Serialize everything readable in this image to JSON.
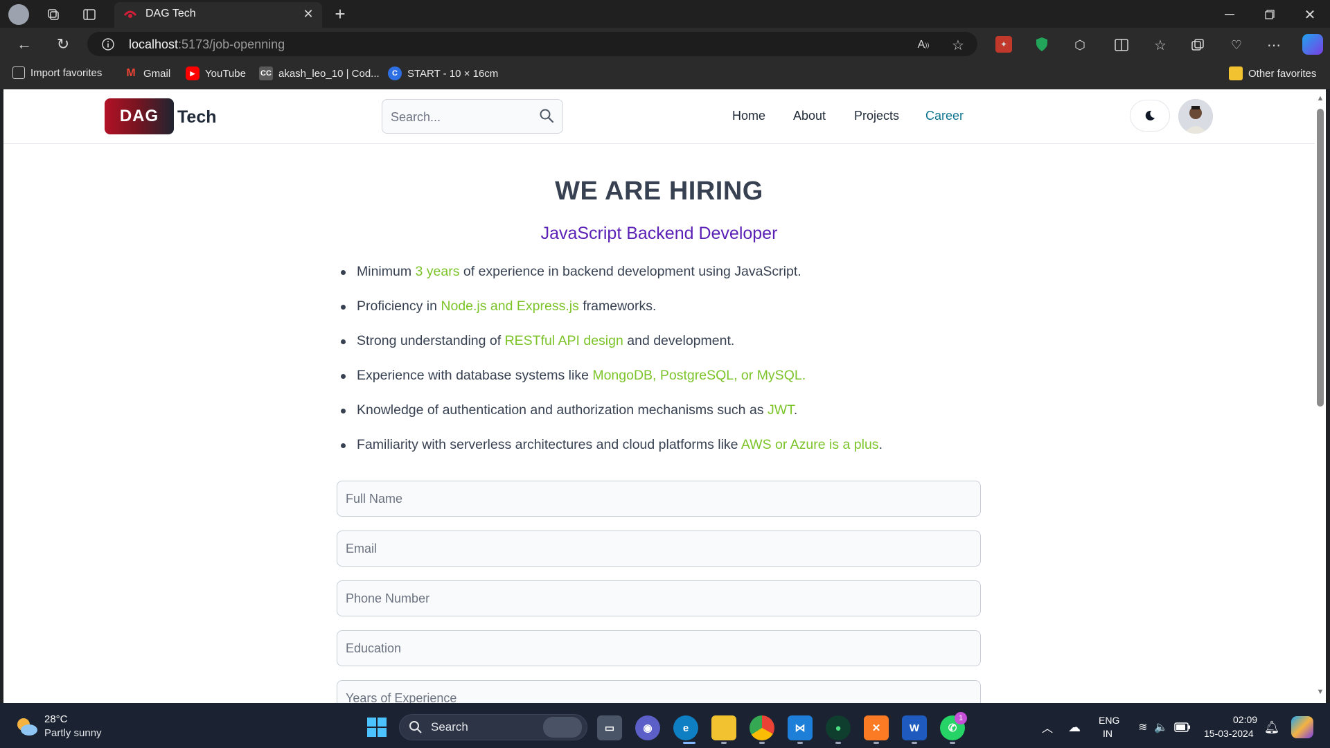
{
  "browser": {
    "tab_title": "DAG Tech",
    "url_host": "localhost",
    "url_path": ":5173/job-openning",
    "favorites": [
      {
        "label": "Import favorites"
      },
      {
        "label": "Gmail"
      },
      {
        "label": "YouTube"
      },
      {
        "label": "akash_leo_10 | Cod..."
      },
      {
        "label": "START - 10 × 16cm"
      }
    ],
    "other_favorites": "Other favorites"
  },
  "navbar": {
    "logo_box": "DAG",
    "logo_rest": "Tech",
    "search_placeholder": "Search...",
    "links": [
      "Home",
      "About",
      "Projects",
      "Career"
    ],
    "active_link": "Career"
  },
  "content": {
    "title": "WE ARE HIRING",
    "job_title": "JavaScript Backend Developer",
    "requirements": [
      {
        "pre": "Minimum ",
        "hl": "3 years",
        "post": " of experience in backend development using JavaScript."
      },
      {
        "pre": "Proficiency in ",
        "hl": "Node.js and Express.js",
        "post": " frameworks."
      },
      {
        "pre": "Strong understanding of ",
        "hl": "RESTful API design",
        "post": " and development."
      },
      {
        "pre": "Experience with database systems like ",
        "hl": "MongoDB, PostgreSQL, or MySQL.",
        "post": ""
      },
      {
        "pre": "Knowledge of authentication and authorization mechanisms such as ",
        "hl": "JWT",
        "post": "."
      },
      {
        "pre": "Familiarity with serverless architectures and cloud platforms like ",
        "hl": "AWS or Azure is a plus",
        "post": "."
      }
    ],
    "form": {
      "full_name_placeholder": "Full Name",
      "email_placeholder": "Email",
      "phone_placeholder": "Phone Number",
      "education_placeholder": "Education",
      "experience_placeholder": "Years of Experience"
    }
  },
  "taskbar": {
    "weather_temp": "28°C",
    "weather_desc": "Partly sunny",
    "search_label": "Search",
    "lang_1": "ENG",
    "lang_2": "IN",
    "time": "02:09",
    "date": "15-03-2024",
    "whatsapp_badge": "1"
  },
  "colors": {
    "highlight": "#7cc42a",
    "job_title": "#5b21b6",
    "active_nav": "#0e7490"
  }
}
